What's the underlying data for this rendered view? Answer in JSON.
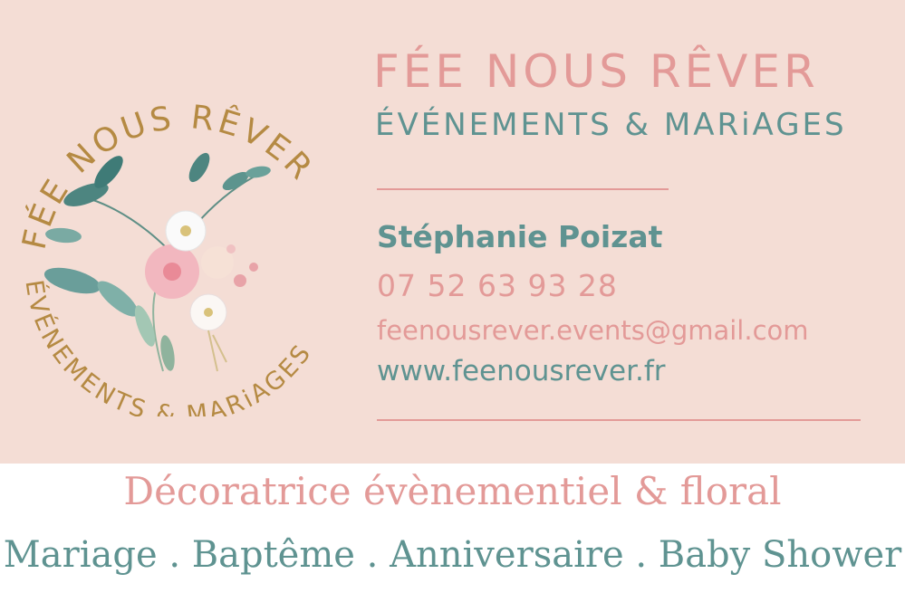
{
  "colors": {
    "card_background": "#f4ddd5",
    "pink": "#e39a98",
    "teal": "#5f9391",
    "gold": "#b58a43",
    "page_background": "#ffffff"
  },
  "logo": {
    "arc_top_text": "FÉE NOUS RÊVER",
    "arc_bottom_text": "ÉVÉNEMENTS & MARiAGES",
    "icon": "floral-bouquet-icon"
  },
  "card": {
    "title": "FÉE NOUS RÊVER",
    "subtitle": "ÉVÉNEMENTS & MARiAGES",
    "name": "Stéphanie Poizat",
    "phone": "07 52 63 93 28",
    "email": "feenousrever.events@gmail.com",
    "website": "www.feenousrever.fr"
  },
  "footer": {
    "tagline": "Décoratrice évènementiel & floral",
    "services": "Mariage . Baptême . Anniversaire . Baby Shower"
  }
}
